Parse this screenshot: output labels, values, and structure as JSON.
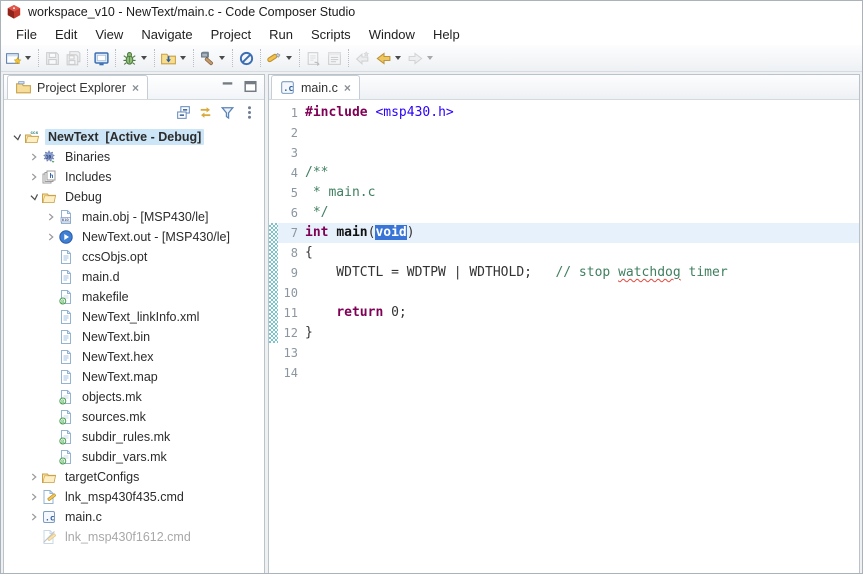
{
  "window": {
    "title": "workspace_v10 - NewText/main.c - Code Composer Studio",
    "logo_icon": "ccs-cube"
  },
  "menu": {
    "items": [
      "File",
      "Edit",
      "View",
      "Navigate",
      "Project",
      "Run",
      "Scripts",
      "Window",
      "Help"
    ]
  },
  "toolbar": {
    "groups": [
      {
        "buttons": [
          {
            "icon": "new-wizard",
            "dropdown": true,
            "enabled": true
          }
        ]
      },
      {
        "buttons": [
          {
            "icon": "save",
            "enabled": false
          },
          {
            "icon": "save-all",
            "enabled": false
          }
        ]
      },
      {
        "buttons": [
          {
            "icon": "console",
            "enabled": true
          }
        ]
      },
      {
        "buttons": [
          {
            "icon": "debug",
            "dropdown": true,
            "enabled": true
          }
        ]
      },
      {
        "buttons": [
          {
            "icon": "flash-folder",
            "dropdown": true,
            "enabled": true
          }
        ]
      },
      {
        "buttons": [
          {
            "icon": "build-hammer",
            "dropdown": true,
            "enabled": true
          }
        ]
      },
      {
        "buttons": [
          {
            "icon": "prohibit",
            "enabled": true
          }
        ]
      },
      {
        "buttons": [
          {
            "icon": "flash-tool",
            "dropdown": true,
            "enabled": true
          }
        ]
      },
      {
        "buttons": [
          {
            "icon": "sync-editor",
            "enabled": false
          },
          {
            "icon": "window-list",
            "enabled": false
          }
        ]
      },
      {
        "buttons": [
          {
            "icon": "last-edit-location",
            "enabled": false
          },
          {
            "icon": "back",
            "dropdown": true,
            "enabled": true
          },
          {
            "icon": "forward",
            "dropdown": true,
            "enabled": false
          }
        ]
      }
    ]
  },
  "explorer": {
    "title": "Project Explorer",
    "toolbar_icons": [
      "collapse-all",
      "link-with-editor",
      "filter",
      "view-menu"
    ],
    "window_icons": [
      "minimize",
      "maximize"
    ],
    "tree": [
      {
        "label": "NewText  [Active - Debug]",
        "level": 0,
        "icon": "ccs-project",
        "expand": "open",
        "selected": true
      },
      {
        "label": "Binaries",
        "level": 1,
        "icon": "binaries",
        "expand": "closed"
      },
      {
        "label": "Includes",
        "level": 1,
        "icon": "includes",
        "expand": "closed"
      },
      {
        "label": "Debug",
        "level": 1,
        "icon": "folder-open",
        "expand": "open"
      },
      {
        "label": "main.obj - [MSP430/le]",
        "level": 2,
        "icon": "obj-file",
        "expand": "closed"
      },
      {
        "label": "NewText.out - [MSP430/le]",
        "level": 2,
        "icon": "out-file",
        "expand": "closed"
      },
      {
        "label": "ccsObjs.opt",
        "level": 2,
        "icon": "text-file"
      },
      {
        "label": "main.d",
        "level": 2,
        "icon": "text-file"
      },
      {
        "label": "makefile",
        "level": 2,
        "icon": "makefile"
      },
      {
        "label": "NewText_linkInfo.xml",
        "level": 2,
        "icon": "text-file"
      },
      {
        "label": "NewText.bin",
        "level": 2,
        "icon": "text-file"
      },
      {
        "label": "NewText.hex",
        "level": 2,
        "icon": "text-file"
      },
      {
        "label": "NewText.map",
        "level": 2,
        "icon": "text-file"
      },
      {
        "label": "objects.mk",
        "level": 2,
        "icon": "makefile"
      },
      {
        "label": "sources.mk",
        "level": 2,
        "icon": "makefile"
      },
      {
        "label": "subdir_rules.mk",
        "level": 2,
        "icon": "makefile"
      },
      {
        "label": "subdir_vars.mk",
        "level": 2,
        "icon": "makefile"
      },
      {
        "label": "targetConfigs",
        "level": 1,
        "icon": "folder-open",
        "expand": "closed"
      },
      {
        "label": "lnk_msp430f435.cmd",
        "level": 1,
        "icon": "cmd-file",
        "expand": "closed"
      },
      {
        "label": "main.c",
        "level": 1,
        "icon": "c-file",
        "expand": "closed"
      },
      {
        "label": "lnk_msp430f1612.cmd",
        "level": 1,
        "icon": "cmd-file-excluded",
        "grayed": true
      }
    ]
  },
  "editor": {
    "tab": "main.c",
    "lines": [
      {
        "n": 1,
        "segs": [
          {
            "t": "#include",
            "s": "directive"
          },
          {
            "t": " "
          },
          {
            "t": "<msp430.h>",
            "s": "string"
          }
        ]
      },
      {
        "n": 2,
        "segs": []
      },
      {
        "n": 3,
        "segs": []
      },
      {
        "n": 4,
        "segs": [
          {
            "t": "/**",
            "s": "comment"
          }
        ]
      },
      {
        "n": 5,
        "segs": [
          {
            "t": " * main.c",
            "s": "comment"
          }
        ]
      },
      {
        "n": 6,
        "segs": [
          {
            "t": " */",
            "s": "comment"
          }
        ]
      },
      {
        "n": 7,
        "current": true,
        "range": true,
        "segs": [
          {
            "t": "int",
            "s": "keyword"
          },
          {
            "t": " "
          },
          {
            "t": "main",
            "s": "func"
          },
          {
            "t": "("
          },
          {
            "t": "void",
            "s": "keyword selected"
          },
          {
            "t": ")"
          }
        ]
      },
      {
        "n": 8,
        "range": true,
        "segs": [
          {
            "t": "{"
          }
        ]
      },
      {
        "n": 9,
        "range": true,
        "segs": [
          {
            "t": "    WDTCTL = WDTPW | WDTHOLD;   "
          },
          {
            "t": "// stop ",
            "s": "comment"
          },
          {
            "t": "watchdog",
            "s": "comment squiggle"
          },
          {
            "t": " timer",
            "s": "comment"
          }
        ]
      },
      {
        "n": 10,
        "range": true,
        "segs": []
      },
      {
        "n": 11,
        "range": true,
        "segs": [
          {
            "t": "    "
          },
          {
            "t": "return",
            "s": "keyword"
          },
          {
            "t": " 0;"
          }
        ]
      },
      {
        "n": 12,
        "range": true,
        "segs": [
          {
            "t": "}"
          }
        ]
      },
      {
        "n": 13,
        "segs": []
      },
      {
        "n": 14,
        "segs": []
      }
    ]
  },
  "colors": {
    "selection": "#3875d6",
    "current_line": "#e6f1fc",
    "keyword": "#7f0055",
    "comment": "#3f7f5f",
    "include_string": "#2a00ff",
    "tree_selection": "#cde6f7",
    "range_indicator": "#7cc4cb"
  }
}
